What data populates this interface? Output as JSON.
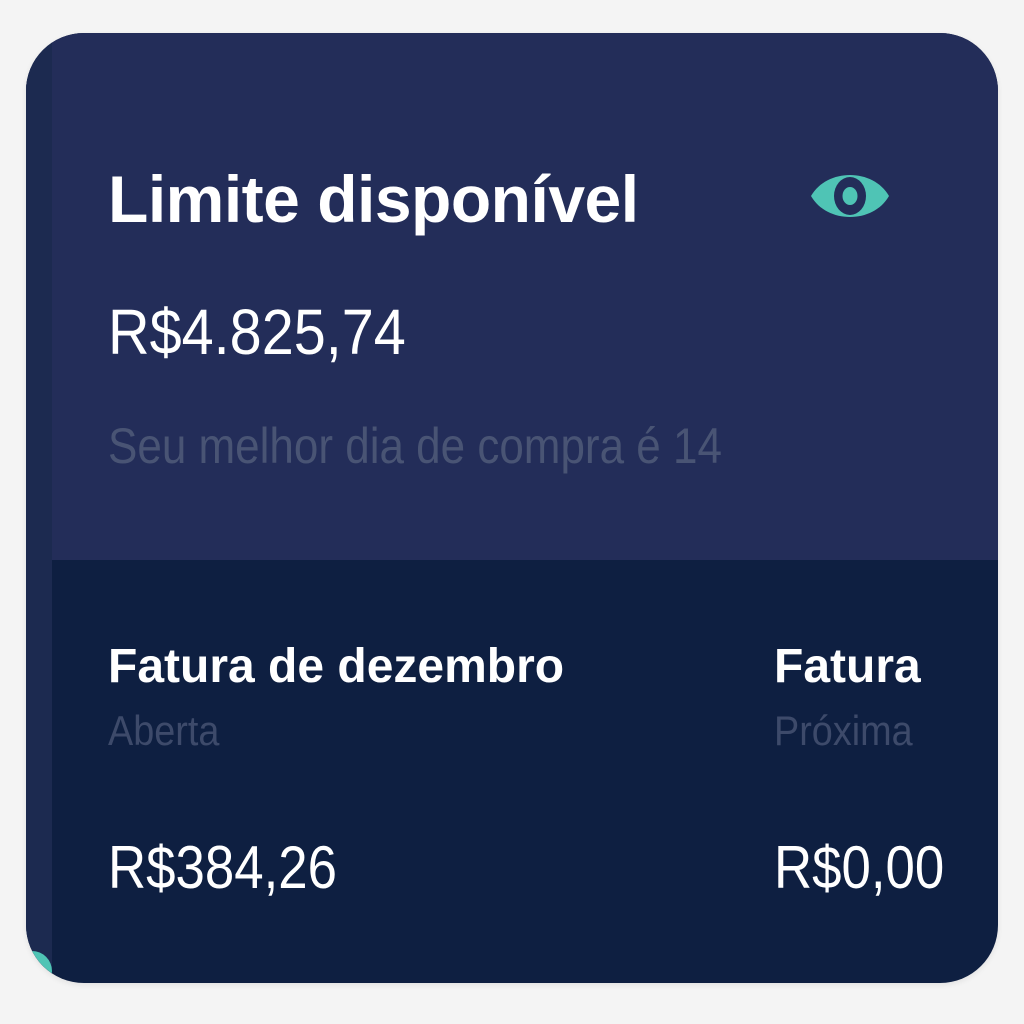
{
  "card": {
    "title": "Limite disponível",
    "available_limit": "R$4.825,74",
    "best_day_hint": "Seu melhor dia de compra é 14",
    "visibility_icon": "eye-icon"
  },
  "bills": [
    {
      "title": "Fatura de dezembro",
      "status": "Aberta",
      "amount": "R$384,26"
    },
    {
      "title": "Fatura",
      "status": "Próxima",
      "amount": "R$0,00"
    }
  ],
  "colors": {
    "top_background": "#232d59",
    "bottom_background": "#0e1f41",
    "accent": "#4fc4b5",
    "text_primary": "#ffffff",
    "text_muted": "#495474"
  }
}
